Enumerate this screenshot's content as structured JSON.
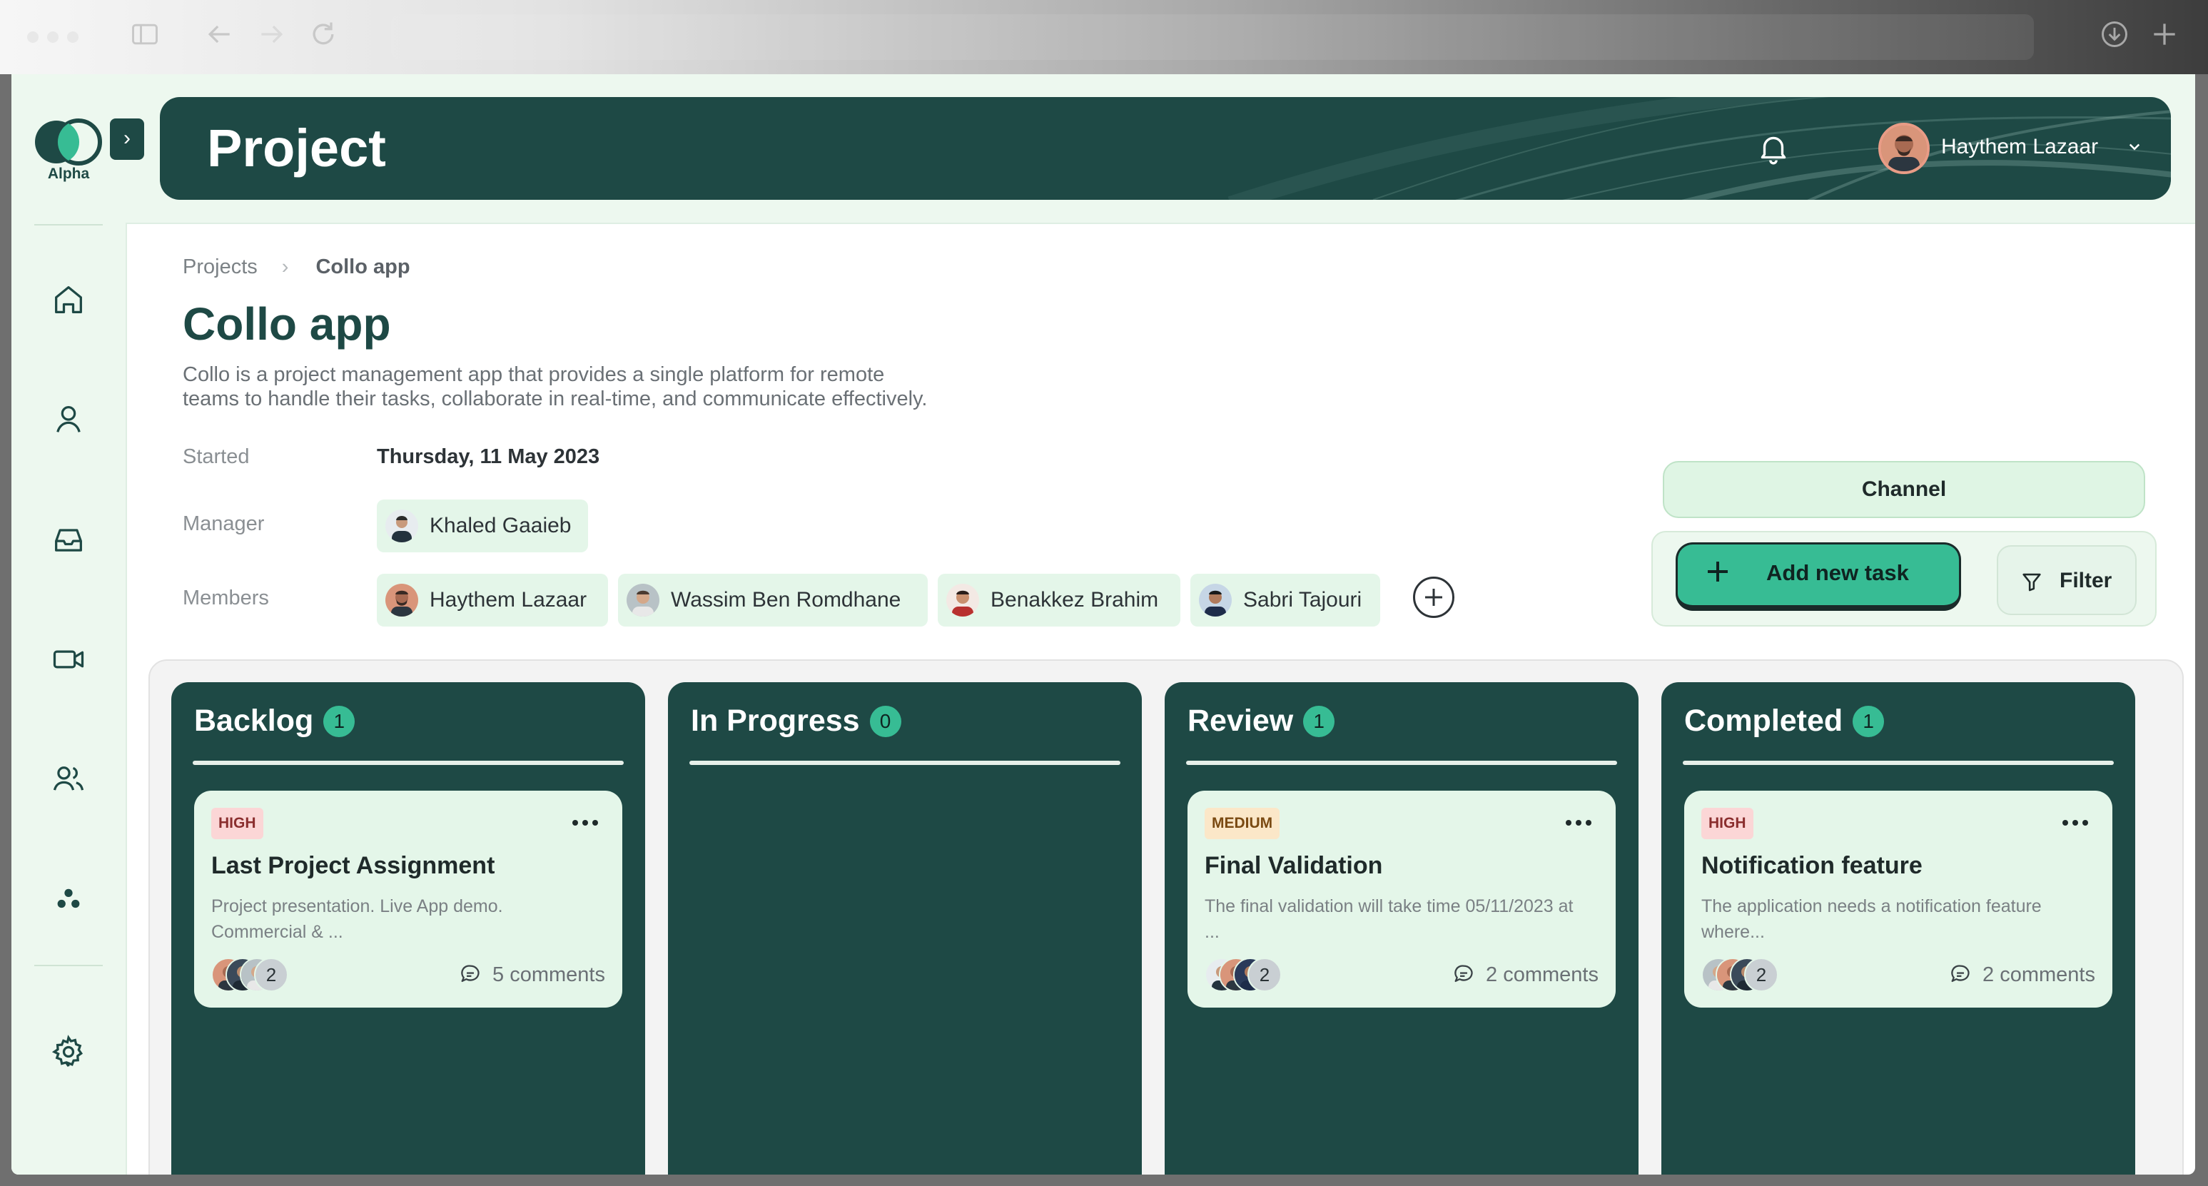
{
  "header": {
    "title": "Project",
    "user_name": "Haythem Lazaar"
  },
  "sidebar": {
    "logo_text": "Alpha"
  },
  "breadcrumb": {
    "root": "Projects",
    "current": "Collo app"
  },
  "project": {
    "title": "Collo app",
    "description_line1": "Collo is a project management app that provides a single platform for remote",
    "description_line2": "teams to handle their tasks, collaborate in real-time, and communicate effectively.",
    "started_label": "Started",
    "started_value": "Thursday, 11 May 2023",
    "manager_label": "Manager",
    "manager_name": "Khaled Gaaieb",
    "members_label": "Members",
    "members": [
      "Haythem Lazaar",
      "Wassim Ben Romdhane",
      "Benakkez Brahim",
      "Sabri Tajouri"
    ]
  },
  "actions": {
    "channel": "Channel",
    "add_task": "Add new task",
    "filter": "Filter"
  },
  "columns": [
    {
      "title": "Backlog",
      "count": "1"
    },
    {
      "title": "In Progress",
      "count": "0"
    },
    {
      "title": "Review",
      "count": "1"
    },
    {
      "title": "Completed",
      "count": "1"
    }
  ],
  "cards": [
    {
      "priority": "HIGH",
      "title": "Last Project Assignment",
      "desc1": "Project presentation. Live App demo.",
      "desc2": "Commercial & ...",
      "more": "2",
      "comments": "5 comments"
    },
    {
      "priority": "MEDIUM",
      "title": "Final Validation",
      "desc1": "The final validation will take time 05/11/2023 at",
      "desc2": "...",
      "more": "2",
      "comments": "2 comments"
    },
    {
      "priority": "HIGH",
      "title": "Notification feature",
      "desc1": "The application needs a notification feature",
      "desc2": "where...",
      "more": "2",
      "comments": "2 comments"
    }
  ],
  "colors": {
    "primary": "#1e4945",
    "accent": "#37bc94",
    "light": "#edf8ef",
    "high": "#fbd6d6",
    "medium": "#fbe7c8"
  },
  "icons": {
    "sidebar": [
      "home-icon",
      "user-icon",
      "inbox-icon",
      "video-icon",
      "team-icon",
      "dots-cluster-icon",
      "settings-icon"
    ],
    "header": [
      "bell-icon",
      "chevron-down-icon"
    ]
  }
}
